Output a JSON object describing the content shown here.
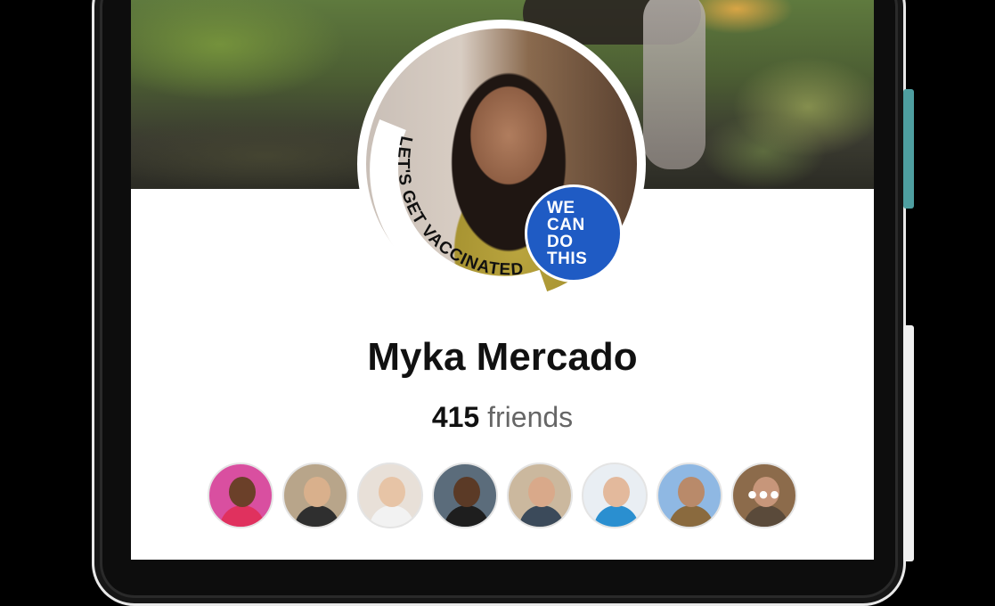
{
  "profile": {
    "name": "Myka Mercado",
    "friends_count": "415",
    "friends_label": "friends",
    "frame_text": "LET'S GET VACCINATED",
    "badge_text": "WE CAN DO THIS"
  },
  "friends": [
    {
      "name": "friend-1",
      "bg": "#d94fa0",
      "skin": "#6b4029",
      "shirt": "#e0315e"
    },
    {
      "name": "friend-2",
      "bg": "#b8a58a",
      "skin": "#d9b08c",
      "shirt": "#2f2f2f"
    },
    {
      "name": "friend-3",
      "bg": "#e8e0d8",
      "skin": "#e7c4a6",
      "shirt": "#f2f2f2"
    },
    {
      "name": "friend-4",
      "bg": "#5b6c7b",
      "skin": "#5b3a26",
      "shirt": "#1e1e1e"
    },
    {
      "name": "friend-5",
      "bg": "#cbb89e",
      "skin": "#d9a98a",
      "shirt": "#3b4a5a"
    },
    {
      "name": "friend-6",
      "bg": "#e9eef3",
      "skin": "#e3b99c",
      "shirt": "#2a8fd0"
    },
    {
      "name": "friend-7",
      "bg": "#8fb8e3",
      "skin": "#b98a6a",
      "shirt": "#8a6a3e"
    },
    {
      "name": "friend-8",
      "bg": "#8c6b4b",
      "skin": "#c7967a",
      "shirt": "#5a4a3a"
    }
  ],
  "more_indicator": "•••",
  "colors": {
    "badge": "#1f5bc4",
    "frame_ring": "#ffffff"
  }
}
